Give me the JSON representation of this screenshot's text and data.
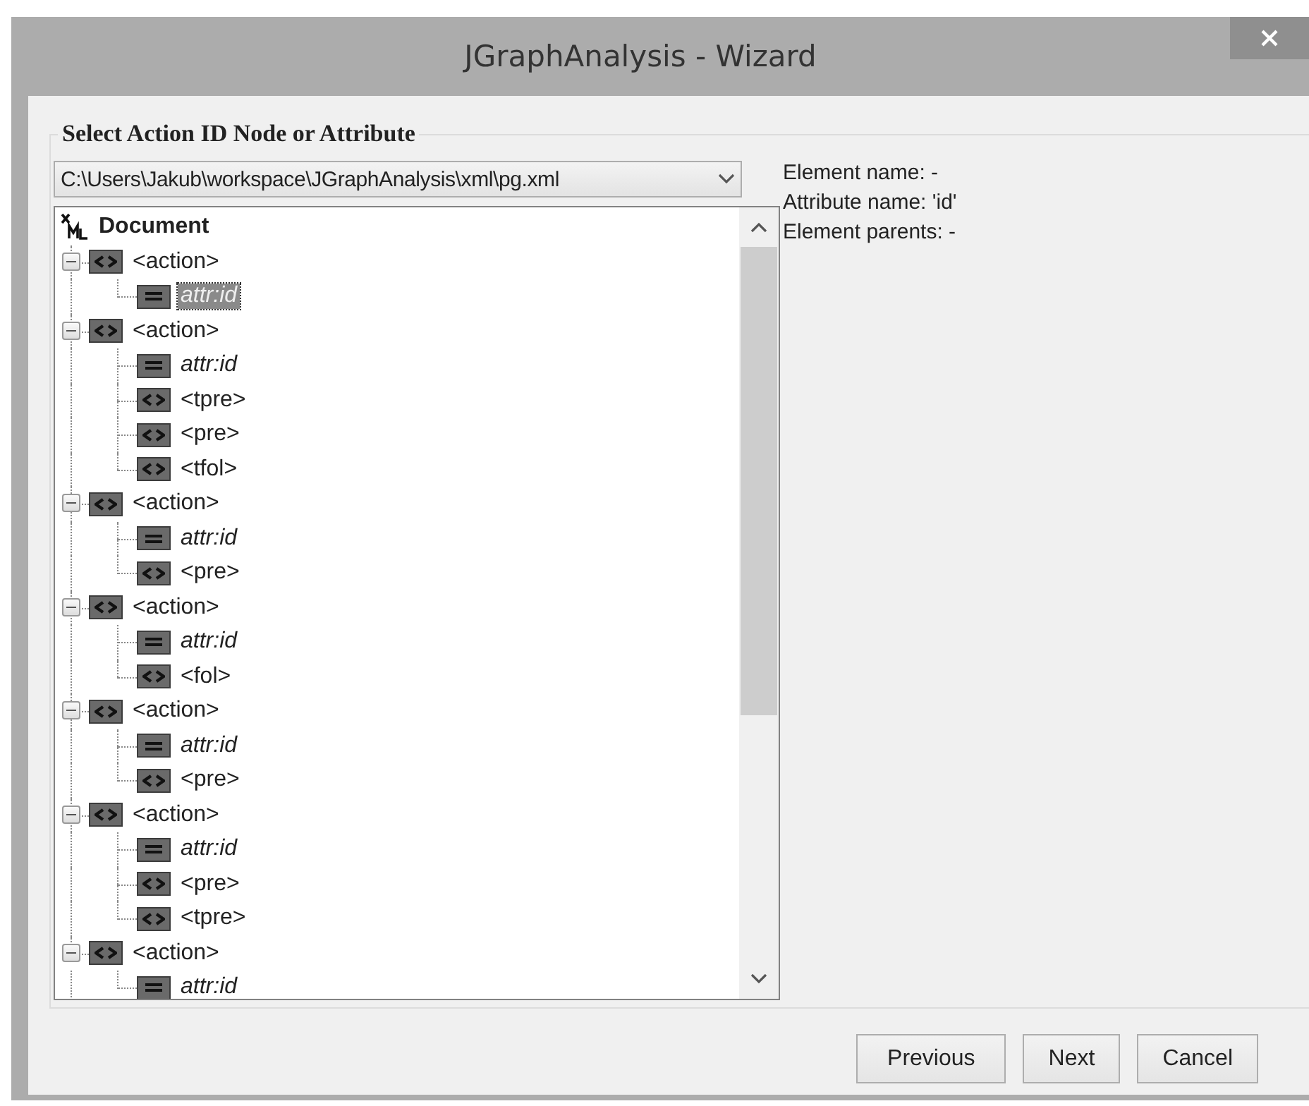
{
  "window": {
    "title": "JGraphAnalysis - Wizard"
  },
  "group": {
    "title": "Select Action ID Node or Attribute"
  },
  "file_combo": {
    "value": "C:\\Users\\Jakub\\workspace\\JGraphAnalysis\\xml\\pg.xml"
  },
  "tree": {
    "root": {
      "label": "Document",
      "kind": "root",
      "selected": false,
      "children": [
        {
          "label": "<action>",
          "kind": "element",
          "expanded": true,
          "selected": false,
          "children": [
            {
              "label": "attr:id",
              "kind": "attribute",
              "selected": true
            }
          ]
        },
        {
          "label": "<action>",
          "kind": "element",
          "expanded": true,
          "selected": false,
          "children": [
            {
              "label": "attr:id",
              "kind": "attribute",
              "selected": false
            },
            {
              "label": "<tpre>",
              "kind": "element",
              "selected": false
            },
            {
              "label": "<pre>",
              "kind": "element",
              "selected": false
            },
            {
              "label": "<tfol>",
              "kind": "element",
              "selected": false
            }
          ]
        },
        {
          "label": "<action>",
          "kind": "element",
          "expanded": true,
          "selected": false,
          "children": [
            {
              "label": "attr:id",
              "kind": "attribute",
              "selected": false
            },
            {
              "label": "<pre>",
              "kind": "element",
              "selected": false
            }
          ]
        },
        {
          "label": "<action>",
          "kind": "element",
          "expanded": true,
          "selected": false,
          "children": [
            {
              "label": "attr:id",
              "kind": "attribute",
              "selected": false
            },
            {
              "label": "<fol>",
              "kind": "element",
              "selected": false
            }
          ]
        },
        {
          "label": "<action>",
          "kind": "element",
          "expanded": true,
          "selected": false,
          "children": [
            {
              "label": "attr:id",
              "kind": "attribute",
              "selected": false
            },
            {
              "label": "<pre>",
              "kind": "element",
              "selected": false
            }
          ]
        },
        {
          "label": "<action>",
          "kind": "element",
          "expanded": true,
          "selected": false,
          "children": [
            {
              "label": "attr:id",
              "kind": "attribute",
              "selected": false
            },
            {
              "label": "<pre>",
              "kind": "element",
              "selected": false
            },
            {
              "label": "<tpre>",
              "kind": "element",
              "selected": false
            }
          ]
        },
        {
          "label": "<action>",
          "kind": "element",
          "expanded": true,
          "selected": false,
          "children": [
            {
              "label": "attr:id",
              "kind": "attribute",
              "selected": false
            }
          ]
        }
      ]
    }
  },
  "info": [
    "Element name: -",
    "Attribute name: 'id'",
    "Element parents: -"
  ],
  "buttons": [
    "Previous",
    "Next",
    "Cancel"
  ]
}
